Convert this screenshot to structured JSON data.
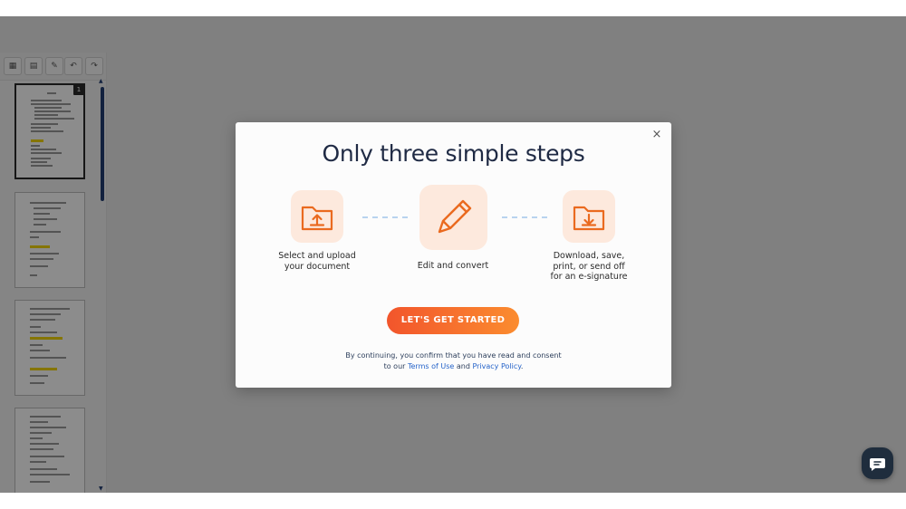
{
  "toolbar": {
    "buttons": [
      {
        "icon": "grid-icon",
        "glyph": "▦"
      },
      {
        "icon": "document-icon",
        "glyph": "▤"
      },
      {
        "icon": "edit-icon",
        "glyph": "✎"
      },
      {
        "icon": "undo-icon",
        "glyph": "↶"
      },
      {
        "icon": "redo-icon",
        "glyph": "↷"
      }
    ]
  },
  "thumbnails": {
    "current_page": "1",
    "pages": 4
  },
  "modal": {
    "title": "Only three simple steps",
    "close_label": "×",
    "steps": [
      {
        "icon": "folder-upload-icon",
        "line1": "Select and upload",
        "line2": "your document",
        "line3": "",
        "line4": ""
      },
      {
        "icon": "pencil-icon",
        "line1": "Edit and convert",
        "line2": "",
        "line3": "",
        "line4": ""
      },
      {
        "icon": "folder-download-icon",
        "line1": "Download, save,",
        "line2": "print, or send off",
        "line3": "for an e-signature",
        "line4": ""
      }
    ],
    "cta_label": "LET'S GET STARTED",
    "consent": {
      "line1": "By continuing, you confirm that you have read and consent",
      "prefix": "to our ",
      "terms_link": "Terms of Use",
      "and": " and ",
      "privacy_link": "Privacy Policy",
      "suffix": "."
    }
  },
  "chat": {
    "icon": "chat-icon"
  },
  "colors": {
    "accent_start": "#f2552c",
    "accent_end": "#fb8c2f",
    "icon_orange": "#ea6a1f",
    "icon_bg": "#fde9dd",
    "title": "#1f2a44",
    "link": "#2563c9",
    "chat_bg": "#1f2d3d"
  }
}
